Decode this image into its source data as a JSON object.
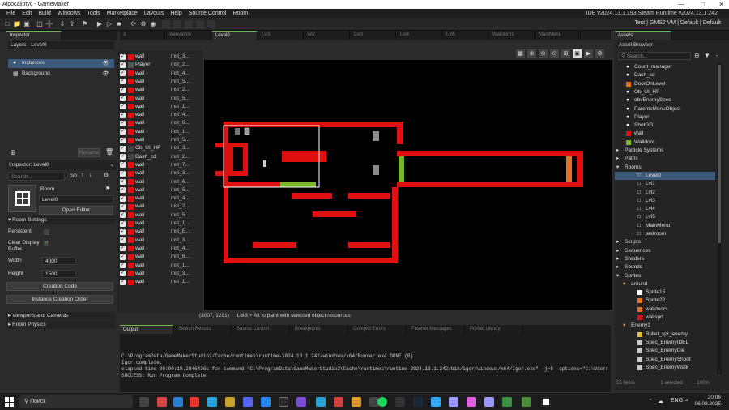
{
  "window": {
    "title": "Aipocaliptyc - GameMaker"
  },
  "menu": [
    "File",
    "Edit",
    "Build",
    "Windows",
    "Tools",
    "Marketplace",
    "Layouts",
    "Help",
    "Source Control",
    "Room"
  ],
  "ide_version": "IDE v2024.13.1.193 Steam  Runtime v2024.13.1.242",
  "target": "Test | GMS2 VM | Default | Default",
  "inspector": {
    "tab": "Inspector",
    "header": "Layers - Level0",
    "layers": [
      "Instances",
      "Background"
    ],
    "inspector2_title": "Inspector: Level0",
    "search_placeholder": "Search...",
    "count": "0/0",
    "room_label": "Room",
    "room_name": "Level0",
    "open_editor": "Open Editor",
    "room_settings": "Room Settings",
    "persistent": "Persistent",
    "clear_display": "Clear Display",
    "buffer": "Buffer",
    "width_label": "Width",
    "width": "4000",
    "height_label": "Height",
    "height": "1500",
    "creation_code": "Creation Code",
    "instance_order": "Instance Creation Order",
    "viewports": "Viewports and Cameras",
    "physics": "Room Physics",
    "rename": "Rename"
  },
  "instances": [
    {
      "name": "wall",
      "id": "inst_3..."
    },
    {
      "name": "Player",
      "id": "inst_2..."
    },
    {
      "name": "wall",
      "id": "inst_4..."
    },
    {
      "name": "wall",
      "id": "inst_5..."
    },
    {
      "name": "wall",
      "id": "inst_2..."
    },
    {
      "name": "wall",
      "id": "inst_5..."
    },
    {
      "name": "wall",
      "id": "inst_1..."
    },
    {
      "name": "wall",
      "id": "inst_4..."
    },
    {
      "name": "wall",
      "id": "inst_6..."
    },
    {
      "name": "wall",
      "id": "inst_1..."
    },
    {
      "name": "wall",
      "id": "inst_5..."
    },
    {
      "name": "Ob_UI_HP",
      "id": "inst_3..."
    },
    {
      "name": "Dash_cd",
      "id": "inst_2..."
    },
    {
      "name": "wall",
      "id": "inst_7..."
    },
    {
      "name": "wall",
      "id": "inst_3..."
    },
    {
      "name": "wall",
      "id": "inst_6..."
    },
    {
      "name": "wall",
      "id": "inst_5..."
    },
    {
      "name": "wall",
      "id": "inst_4..."
    },
    {
      "name": "wall",
      "id": "inst_2..."
    },
    {
      "name": "wall",
      "id": "inst_5..."
    },
    {
      "name": "wall",
      "id": "inst_1..."
    },
    {
      "name": "wall",
      "id": "inst_E..."
    },
    {
      "name": "wall",
      "id": "inst_3..."
    },
    {
      "name": "wall",
      "id": "inst_4..."
    },
    {
      "name": "wall",
      "id": "inst_6..."
    },
    {
      "name": "wall",
      "id": "inst_1..."
    },
    {
      "name": "wall",
      "id": "inst_3..."
    },
    {
      "name": "wall",
      "id": "inst_1..."
    }
  ],
  "room_tabs": [
    "3",
    "weevamm",
    "Level0",
    "Lvl1",
    "lvl2",
    "Lvl3",
    "Lvl4",
    "Lvl5",
    "Walldoors",
    "MainMenu"
  ],
  "status": {
    "coords": "(3007, 1291)",
    "hint": "LMB + Alt to paint with selected object resources"
  },
  "output": {
    "tabs": [
      "Output",
      "Search Results",
      "Source Control",
      "Breakpoints",
      "Compile Errors",
      "Feather Messages",
      "Prefab Library"
    ],
    "lines": [
      "C:\\ProgramData/GameMakerStudio2/Cache/runtimes\\runtime-2024.13.1.242/windows/x64/Runner.exe DONE (0)",
      "Igor complete.",
      "elapsed time 00:00:19.2846436s for command \"C:\\ProgramData\\GameMakerStudio2\\Cache\\runtimes\\runtime-2024.13.1.242/bin/igor/windows/x64/Igor.exe\" -j=8  -options=\"C:\\Users\\Nicolas Janar",
      "SUCCESS: Run Program Complete"
    ]
  },
  "assets": {
    "tab": "Assets",
    "browser": "Asset Browser",
    "search_placeholder": "Search...",
    "items": [
      {
        "label": "Count_manager",
        "kind": "obj",
        "color": "#ffffff"
      },
      {
        "label": "Dash_cd",
        "kind": "obj",
        "color": "#ffffff"
      },
      {
        "label": "DoorOnLevel",
        "kind": "spr",
        "color": "#e8721c"
      },
      {
        "label": "Ob_UI_HP",
        "kind": "obj",
        "color": "#ffffff"
      },
      {
        "label": "obvEnemySpec",
        "kind": "obj",
        "color": "#ffffff"
      },
      {
        "label": "ParentsMenuObject",
        "kind": "obj",
        "color": "#ffffff"
      },
      {
        "label": "Player",
        "kind": "obj",
        "color": "#ffffff"
      },
      {
        "label": "ShotGG",
        "kind": "obj",
        "color": "#ffffff"
      },
      {
        "label": "wall",
        "kind": "spr",
        "color": "#e01010"
      },
      {
        "label": "Walldoor",
        "kind": "spr",
        "color": "#76b82a"
      },
      {
        "label": "Particle Systems",
        "kind": "folder"
      },
      {
        "label": "Paths",
        "kind": "folder"
      },
      {
        "label": "Rooms",
        "kind": "folder-open"
      },
      {
        "label": "Level0",
        "kind": "room",
        "selected": true
      },
      {
        "label": "Lvl1",
        "kind": "room"
      },
      {
        "label": "Lvl2",
        "kind": "room"
      },
      {
        "label": "Lvl3",
        "kind": "room"
      },
      {
        "label": "Lvl4",
        "kind": "room"
      },
      {
        "label": "Lvl5",
        "kind": "room"
      },
      {
        "label": "MainMenu",
        "kind": "room"
      },
      {
        "label": "testroom",
        "kind": "room"
      },
      {
        "label": "Scripts",
        "kind": "folder"
      },
      {
        "label": "Sequences",
        "kind": "folder"
      },
      {
        "label": "Shaders",
        "kind": "folder"
      },
      {
        "label": "Sounds",
        "kind": "folder"
      },
      {
        "label": "Sprites",
        "kind": "folder-open"
      },
      {
        "label": "around",
        "kind": "sub"
      },
      {
        "label": "Sprite15",
        "kind": "spr",
        "color": "#ffffff"
      },
      {
        "label": "Sprite22",
        "kind": "spr",
        "color": "#e8721c"
      },
      {
        "label": "walldoors",
        "kind": "spr",
        "color": "#e8721c"
      },
      {
        "label": "wallsprt",
        "kind": "spr",
        "color": "#e01010"
      },
      {
        "label": "Enemy1",
        "kind": "sub"
      },
      {
        "label": "Bullet_spr_enemy",
        "kind": "spr",
        "color": "#e8c33a"
      },
      {
        "label": "Spec_EnemyIDEL",
        "kind": "spr",
        "color": "#cccccc"
      },
      {
        "label": "Spec_EnemyDie",
        "kind": "spr",
        "color": "#cccccc"
      },
      {
        "label": "Spec_EnemyShoot",
        "kind": "spr",
        "color": "#cccccc"
      },
      {
        "label": "Spec_EnemyWalk",
        "kind": "spr",
        "color": "#cccccc"
      }
    ],
    "footer_left": "55 items",
    "footer_right": "1 selected",
    "zoom": "100%"
  },
  "taskbar": {
    "search": "Поиск",
    "time": "20:06",
    "date": "06.08.2025",
    "lang": "ENG"
  },
  "colors": {
    "wall": "#e01010",
    "walldoor": "#76b82a",
    "door": "#e8721c",
    "accent": "#6fb84a"
  }
}
